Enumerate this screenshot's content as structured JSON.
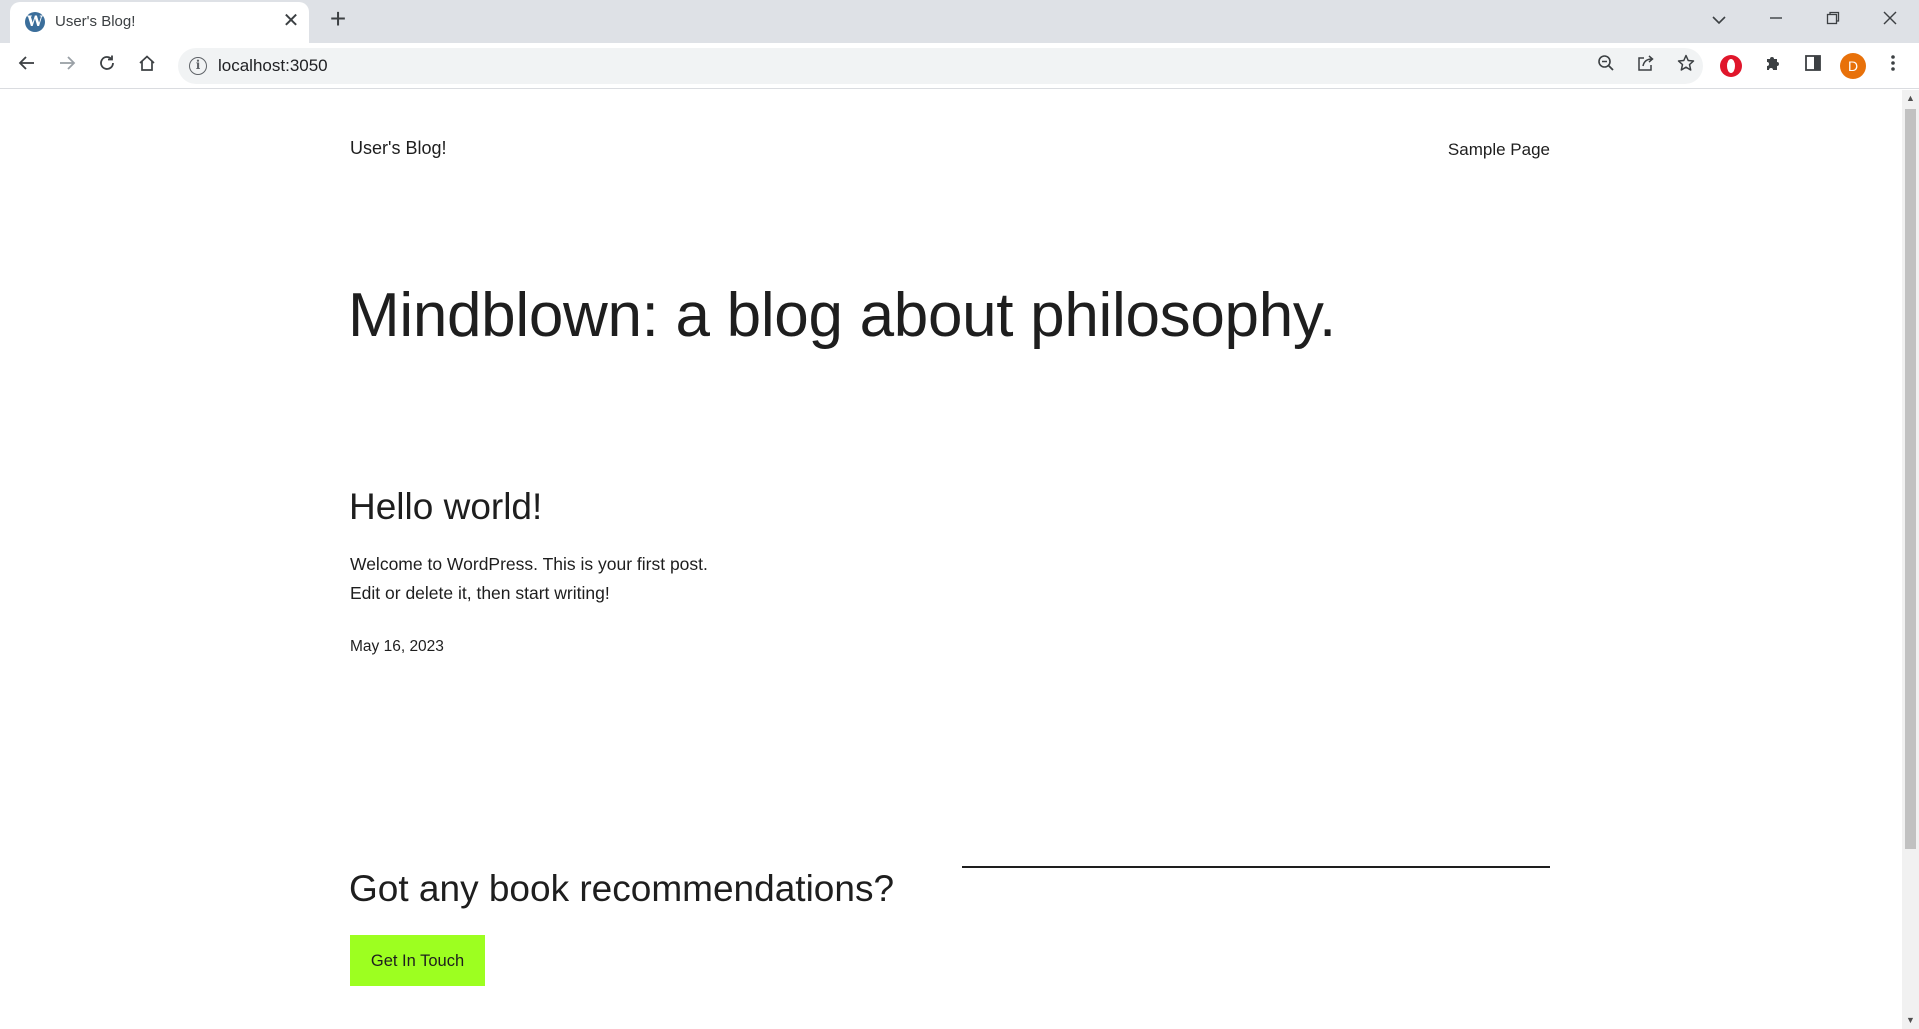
{
  "browser": {
    "tab": {
      "title": "User's Blog!",
      "favicon": "wordpress-icon"
    },
    "address": {
      "url": "localhost:3050"
    },
    "avatar_initial": "D",
    "colors": {
      "tabstrip": "#dee1e6",
      "avatar": "#e8710a",
      "opera_extension": "#e0162b"
    }
  },
  "site": {
    "title": "User's Blog!",
    "nav": {
      "sample_page": "Sample Page"
    }
  },
  "hero": {
    "title": "Mindblown: a blog about philosophy."
  },
  "post": {
    "title": "Hello world!",
    "excerpt_line1": "Welcome to WordPress. This is your first post.",
    "excerpt_line2": "Edit or delete it, then start writing!",
    "date": "May 16, 2023"
  },
  "cta": {
    "title": "Got any book recommendations?",
    "button_label": "Get In Touch",
    "button_color": "#9dff20"
  }
}
